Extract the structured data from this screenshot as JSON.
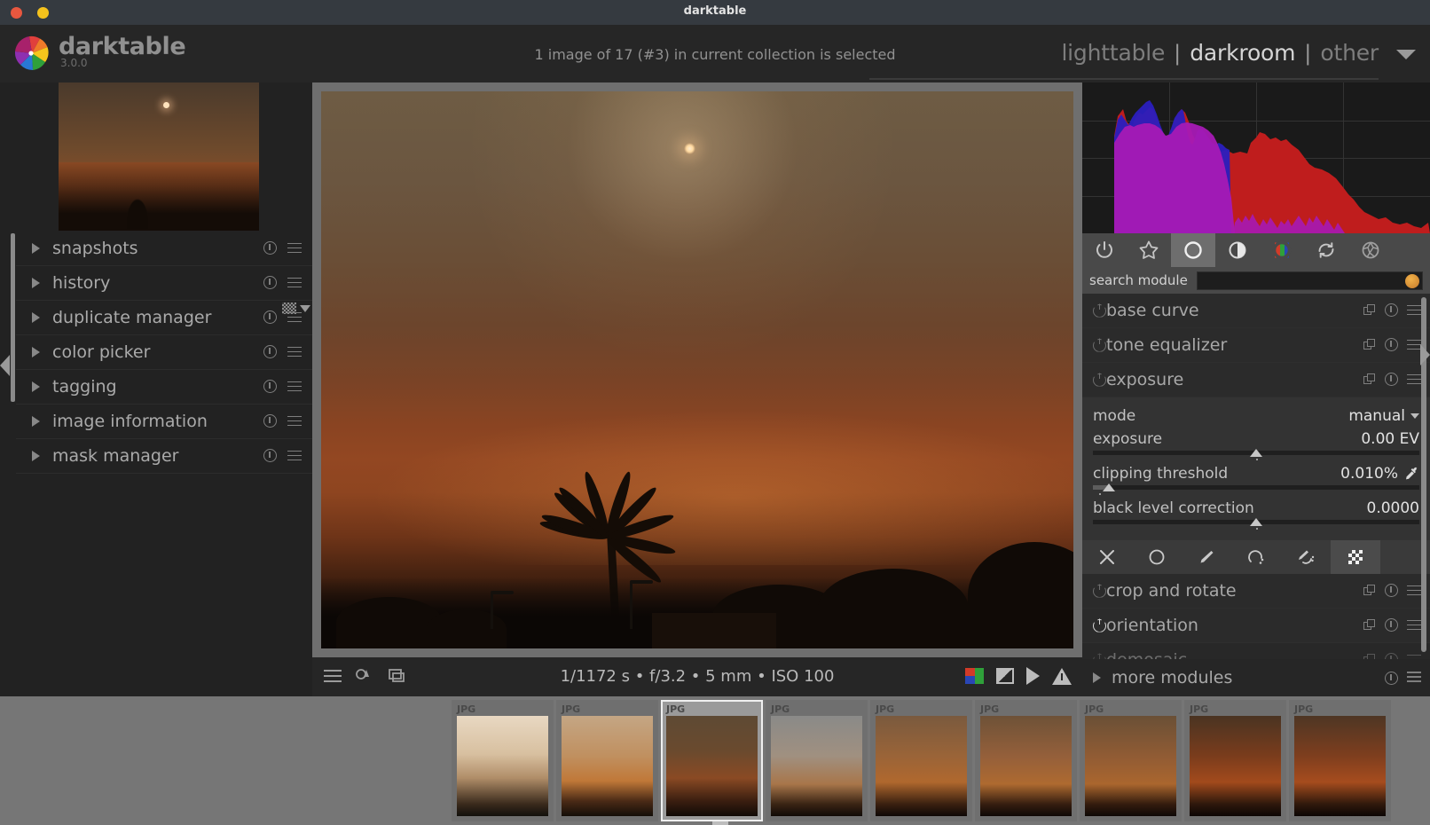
{
  "window": {
    "title": "darktable",
    "close_label": "close",
    "minimize_label": "minimize"
  },
  "header": {
    "app_name": "darktable",
    "version": "3.0.0",
    "status_message": "1 image of 17 (#3) in current collection is selected",
    "views": [
      {
        "label": "lighttable",
        "active": false
      },
      {
        "label": "darkroom",
        "active": true
      },
      {
        "label": "other",
        "active": false
      }
    ],
    "separator": "|"
  },
  "left_panel": {
    "modules": [
      {
        "label": "snapshots"
      },
      {
        "label": "history"
      },
      {
        "label": "duplicate manager"
      },
      {
        "label": "color picker"
      },
      {
        "label": "tagging"
      },
      {
        "label": "image information"
      },
      {
        "label": "mask manager"
      }
    ]
  },
  "center": {
    "metadata": "1/1172 s • f/3.2 • 5 mm • ISO 100",
    "left_icons": [
      "hamburger-icon",
      "color-label-icon",
      "display-profile-icon"
    ],
    "right_icons": [
      "raw-overexposed-icon",
      "gamut-check-icon",
      "softproof-icon",
      "overexposed-warning-icon"
    ]
  },
  "right_panel": {
    "group_icons": [
      {
        "name": "active-modules-icon",
        "active": false
      },
      {
        "name": "favorites-star-icon",
        "active": false
      },
      {
        "name": "tone-circle-icon",
        "active": true
      },
      {
        "name": "grading-halfcircle-icon",
        "active": false
      },
      {
        "name": "color-rgb-icon",
        "active": false
      },
      {
        "name": "correction-arrows-icon",
        "active": false
      },
      {
        "name": "effects-globe-icon",
        "active": false
      }
    ],
    "search": {
      "label": "search module",
      "value": "",
      "placeholder": ""
    },
    "modules": [
      {
        "label": "base curve",
        "enabled": false,
        "expanded": false
      },
      {
        "label": "tone equalizer",
        "enabled": false,
        "expanded": false
      },
      {
        "label": "exposure",
        "enabled": false,
        "expanded": true
      },
      {
        "label": "crop and rotate",
        "enabled": false,
        "expanded": false
      },
      {
        "label": "orientation",
        "enabled": true,
        "expanded": false
      },
      {
        "label": "demosaic",
        "enabled": false,
        "expanded": false
      }
    ],
    "exposure": {
      "mode_label": "mode",
      "mode_value": "manual",
      "exposure_label": "exposure",
      "exposure_value": "0.00 EV",
      "exposure_pct": 50,
      "clipping_label": "clipping threshold",
      "clipping_value": "0.010%",
      "clipping_pct": 5,
      "black_label": "black level correction",
      "black_value": "0.0000",
      "black_pct": 50
    },
    "blend_icons": [
      {
        "name": "blend-off-icon",
        "active": false
      },
      {
        "name": "blend-uniformly-icon",
        "active": false
      },
      {
        "name": "blend-drawn-mask-icon",
        "active": false
      },
      {
        "name": "blend-parametric-mask-icon",
        "active": false
      },
      {
        "name": "blend-drawn-parametric-icon",
        "active": false
      },
      {
        "name": "blend-raster-mask-icon",
        "active": true
      }
    ],
    "more_modules": {
      "label": "more modules"
    }
  },
  "filmstrip": {
    "thumbnails": [
      {
        "format": "JPG",
        "selected": false
      },
      {
        "format": "JPG",
        "selected": false
      },
      {
        "format": "JPG",
        "selected": true
      },
      {
        "format": "JPG",
        "selected": false
      },
      {
        "format": "JPG",
        "selected": false
      },
      {
        "format": "JPG",
        "selected": false
      },
      {
        "format": "JPG",
        "selected": false
      },
      {
        "format": "JPG",
        "selected": false
      },
      {
        "format": "JPG",
        "selected": false
      }
    ]
  }
}
